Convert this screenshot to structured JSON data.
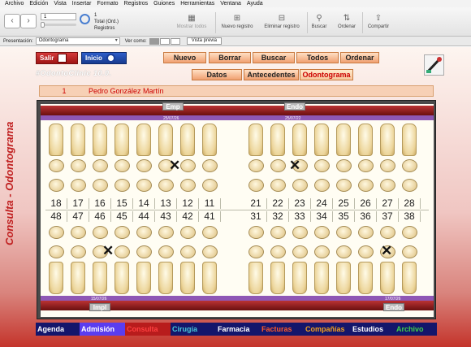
{
  "menu": [
    "Archivo",
    "Edición",
    "Vista",
    "Insertar",
    "Formato",
    "Registros",
    "Guiones",
    "Herramientas",
    "Ventana",
    "Ayuda"
  ],
  "toolbar": {
    "record_value": "1",
    "record_count": "1",
    "total_label": "Total (Ord.)",
    "records_label": "Registros",
    "buttons": [
      {
        "label": "Mostrar todos",
        "icon": "records-icon"
      },
      {
        "label": "Nuevo registro",
        "icon": "plus-icon"
      },
      {
        "label": "Eliminar registro",
        "icon": "minus-icon"
      },
      {
        "label": "Buscar",
        "icon": "search-icon"
      },
      {
        "label": "Ordenar",
        "icon": "sort-icon"
      },
      {
        "label": "Compartir",
        "icon": "share-icon"
      }
    ]
  },
  "layoutbar": {
    "presentacion_label": "Presentación:",
    "presentacion_value": "Odontograma",
    "ver_como_label": "Ver como:",
    "preview_label": "Vista previa"
  },
  "sidebar_title": "Consulta - Odontograma",
  "header": {
    "salir": "Salir",
    "inicio": "Inicio",
    "logo": "#OdontoClinic 10.0.",
    "actions": [
      "Nuevo",
      "Borrar",
      "Buscar",
      "Todos",
      "Ordenar"
    ],
    "tabs": [
      "Datos",
      "Antecedentes",
      "Odontograma"
    ],
    "active_tab": "Odontograma"
  },
  "patient": {
    "number": "1",
    "name": "Pedro González Martín"
  },
  "odontogram": {
    "top_left_tag": "Emp",
    "top_left_date": "25/07/26",
    "top_right_tag": "Endo",
    "top_right_date": "25/07/22",
    "bottom_left_tag": "Impl",
    "bottom_left_date": "15/07/26",
    "bottom_right_tag": "Endo",
    "bottom_right_date": "17/07/26",
    "upper_numbers": [
      "18",
      "17",
      "16",
      "15",
      "14",
      "13",
      "12",
      "11",
      "21",
      "22",
      "23",
      "24",
      "25",
      "26",
      "27",
      "28"
    ],
    "lower_numbers": [
      "48",
      "47",
      "46",
      "45",
      "44",
      "43",
      "42",
      "41",
      "31",
      "32",
      "33",
      "34",
      "35",
      "36",
      "37",
      "38"
    ],
    "marked_teeth": [
      "13",
      "23",
      "46",
      "37"
    ]
  },
  "bottom_nav": [
    {
      "label": "Agenda",
      "color": "#ffffff"
    },
    {
      "label": "Admisión",
      "color": "#ffffff",
      "bg": "#5a3df0"
    },
    {
      "label": "Consulta",
      "color": "#ff4040",
      "bg": "#b81c1c"
    },
    {
      "label": "Cirugía",
      "color": "#46c8d8"
    },
    {
      "label": "Farmacia",
      "color": "#ffffff"
    },
    {
      "label": "Facturas",
      "color": "#ff5a2a"
    },
    {
      "label": "Compañías",
      "color": "#f0a020"
    },
    {
      "label": "Estudios",
      "color": "#ffffff"
    },
    {
      "label": "Archivo",
      "color": "#3fd04a"
    }
  ]
}
